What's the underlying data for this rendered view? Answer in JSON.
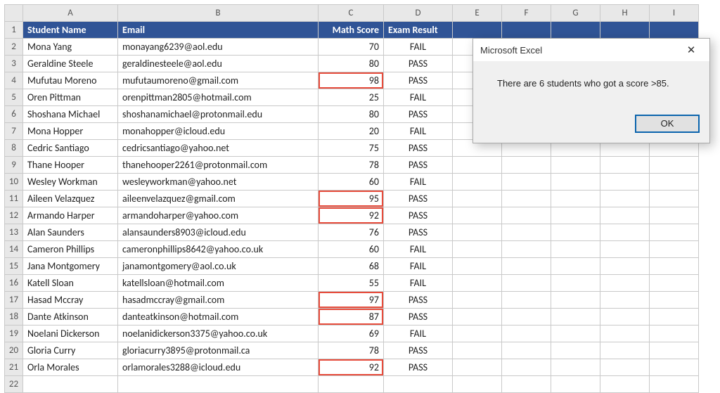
{
  "columns": [
    "A",
    "B",
    "C",
    "D",
    "E",
    "F",
    "G",
    "H",
    "I"
  ],
  "headers": {
    "A": "Student Name",
    "B": "Email",
    "C": "Math Score",
    "D": "Exam Result"
  },
  "rows": [
    {
      "n": 2,
      "name": "Mona Yang",
      "email": "monayang6239@aol.edu",
      "score": 70,
      "result": "FAIL",
      "hl": false
    },
    {
      "n": 3,
      "name": "Geraldine Steele",
      "email": "geraldinesteele@aol.edu",
      "score": 80,
      "result": "PASS",
      "hl": false
    },
    {
      "n": 4,
      "name": "Mufutau Moreno",
      "email": "mufutaumoreno@gmail.com",
      "score": 98,
      "result": "PASS",
      "hl": true
    },
    {
      "n": 5,
      "name": "Oren Pittman",
      "email": "orenpittman2805@hotmail.com",
      "score": 25,
      "result": "FAIL",
      "hl": false
    },
    {
      "n": 6,
      "name": "Shoshana Michael",
      "email": "shoshanamichael@protonmail.edu",
      "score": 80,
      "result": "PASS",
      "hl": false
    },
    {
      "n": 7,
      "name": "Mona Hopper",
      "email": "monahopper@icloud.edu",
      "score": 20,
      "result": "FAIL",
      "hl": false
    },
    {
      "n": 8,
      "name": "Cedric Santiago",
      "email": "cedricsantiago@yahoo.net",
      "score": 75,
      "result": "PASS",
      "hl": false
    },
    {
      "n": 9,
      "name": "Thane Hooper",
      "email": "thanehooper2261@protonmail.com",
      "score": 78,
      "result": "PASS",
      "hl": false
    },
    {
      "n": 10,
      "name": "Wesley Workman",
      "email": "wesleyworkman@yahoo.net",
      "score": 60,
      "result": "FAIL",
      "hl": false
    },
    {
      "n": 11,
      "name": "Aileen Velazquez",
      "email": "aileenvelazquez@gmail.com",
      "score": 95,
      "result": "PASS",
      "hl": true
    },
    {
      "n": 12,
      "name": "Armando Harper",
      "email": "armandoharper@yahoo.com",
      "score": 92,
      "result": "PASS",
      "hl": true
    },
    {
      "n": 13,
      "name": "Alan Saunders",
      "email": "alansaunders8903@icloud.edu",
      "score": 76,
      "result": "PASS",
      "hl": false
    },
    {
      "n": 14,
      "name": "Cameron Phillips",
      "email": "cameronphillips8642@yahoo.co.uk",
      "score": 60,
      "result": "FAIL",
      "hl": false
    },
    {
      "n": 15,
      "name": "Jana Montgomery",
      "email": "janamontgomery@aol.co.uk",
      "score": 68,
      "result": "FAIL",
      "hl": false
    },
    {
      "n": 16,
      "name": "Katell Sloan",
      "email": "katellsloan@hotmail.com",
      "score": 55,
      "result": "FAIL",
      "hl": false
    },
    {
      "n": 17,
      "name": "Hasad Mccray",
      "email": "hasadmccray@gmail.com",
      "score": 97,
      "result": "PASS",
      "hl": true
    },
    {
      "n": 18,
      "name": "Dante Atkinson",
      "email": "danteatkinson@hotmail.com",
      "score": 87,
      "result": "PASS",
      "hl": true
    },
    {
      "n": 19,
      "name": "Noelani Dickerson",
      "email": "noelanidickerson3375@yahoo.co.uk",
      "score": 69,
      "result": "FAIL",
      "hl": false
    },
    {
      "n": 20,
      "name": "Gloria Curry",
      "email": "gloriacurry3895@protonmail.ca",
      "score": 78,
      "result": "PASS",
      "hl": false
    },
    {
      "n": 21,
      "name": "Orla Morales",
      "email": "orlamorales3288@icloud.edu",
      "score": 92,
      "result": "PASS",
      "hl": true
    }
  ],
  "empty_row": 22,
  "dialog": {
    "title": "Microsoft Excel",
    "message": "There are 6 students who got a score >85.",
    "ok_label": "OK"
  },
  "colors": {
    "header_bg": "#305496",
    "highlight": "#e74c3c"
  },
  "chart_data": {
    "type": "table",
    "title": "Student Math Scores",
    "columns": [
      "Student Name",
      "Email",
      "Math Score",
      "Exam Result"
    ],
    "records": [
      [
        "Mona Yang",
        "monayang6239@aol.edu",
        70,
        "FAIL"
      ],
      [
        "Geraldine Steele",
        "geraldinesteele@aol.edu",
        80,
        "PASS"
      ],
      [
        "Mufutau Moreno",
        "mufutaumoreno@gmail.com",
        98,
        "PASS"
      ],
      [
        "Oren Pittman",
        "orenpittman2805@hotmail.com",
        25,
        "FAIL"
      ],
      [
        "Shoshana Michael",
        "shoshanamichael@protonmail.edu",
        80,
        "PASS"
      ],
      [
        "Mona Hopper",
        "monahopper@icloud.edu",
        20,
        "FAIL"
      ],
      [
        "Cedric Santiago",
        "cedricsantiago@yahoo.net",
        75,
        "PASS"
      ],
      [
        "Thane Hooper",
        "thanehooper2261@protonmail.com",
        78,
        "PASS"
      ],
      [
        "Wesley Workman",
        "wesleyworkman@yahoo.net",
        60,
        "FAIL"
      ],
      [
        "Aileen Velazquez",
        "aileenvelazquez@gmail.com",
        95,
        "PASS"
      ],
      [
        "Armando Harper",
        "armandoharper@yahoo.com",
        92,
        "PASS"
      ],
      [
        "Alan Saunders",
        "alansaunders8903@icloud.edu",
        76,
        "PASS"
      ],
      [
        "Cameron Phillips",
        "cameronphillips8642@yahoo.co.uk",
        60,
        "FAIL"
      ],
      [
        "Jana Montgomery",
        "janamontgomery@aol.co.uk",
        68,
        "FAIL"
      ],
      [
        "Katell Sloan",
        "katellsloan@hotmail.com",
        55,
        "FAIL"
      ],
      [
        "Hasad Mccray",
        "hasadmccray@gmail.com",
        97,
        "PASS"
      ],
      [
        "Dante Atkinson",
        "danteatkinson@hotmail.com",
        87,
        "PASS"
      ],
      [
        "Noelani Dickerson",
        "noelanidickerson3375@yahoo.co.uk",
        69,
        "FAIL"
      ],
      [
        "Gloria Curry",
        "gloriacurry3895@protonmail.ca",
        78,
        "PASS"
      ],
      [
        "Orla Morales",
        "orlamorales3288@icloud.edu",
        92,
        "PASS"
      ]
    ]
  }
}
